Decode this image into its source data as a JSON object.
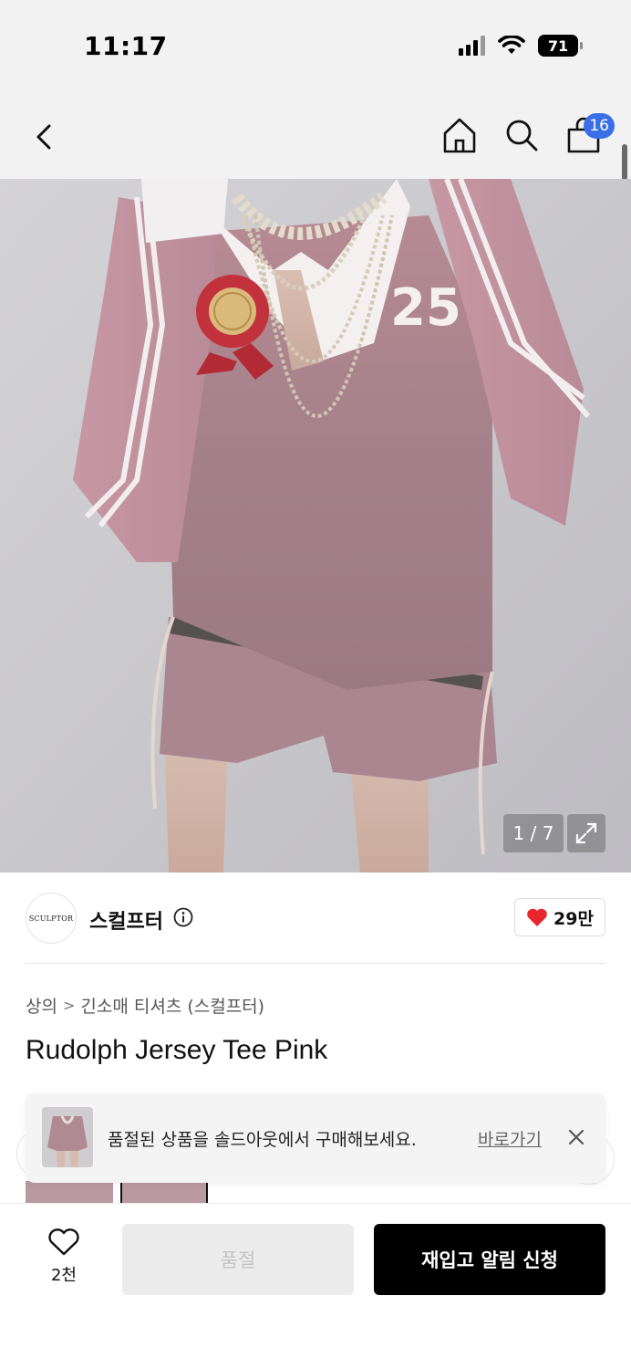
{
  "status_bar": {
    "time": "11:17",
    "battery": "71"
  },
  "nav": {
    "cart_count": "16"
  },
  "gallery": {
    "counter": "1 / 7"
  },
  "brand": {
    "logo_text": "SCULPTOR",
    "name": "스컬프터",
    "likes": "29만"
  },
  "breadcrumb": {
    "level1": "상의",
    "separator": ">",
    "level2": "긴소매 티셔츠 (스컬프터)"
  },
  "product": {
    "title": "Rudolph Jersey Tee Pink"
  },
  "soldout_banner": {
    "message": "품절된 상품을 솔드아웃에서 구매해보세요.",
    "link_label": "바로가기"
  },
  "bottom_bar": {
    "wish_count": "2천",
    "soldout_label": "품절",
    "restock_label": "재입고 알림 신청"
  },
  "colors": {
    "accent_badge": "#3b6fe8",
    "heart": "#e8262d",
    "primary_button": "#000000"
  }
}
